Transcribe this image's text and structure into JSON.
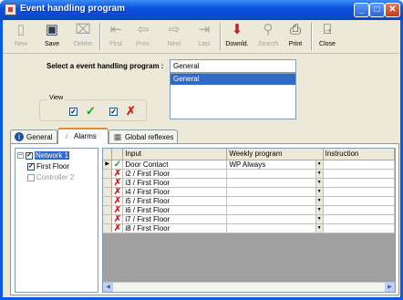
{
  "window": {
    "title": "Event handling program"
  },
  "toolbar": {
    "new": "New",
    "save": "Save",
    "delete": "Delete",
    "first": "First",
    "prev": "Prev.",
    "next": "Next",
    "last": "Last",
    "download": "Downld.",
    "search": "Search",
    "print": "Print",
    "close": "Close"
  },
  "selector": {
    "label": "Select a event handling program :",
    "value": "General",
    "options": [
      "General"
    ]
  },
  "view": {
    "legend": "View",
    "check_mark": "✓",
    "x_mark": "✗"
  },
  "tabs": [
    {
      "label": "General",
      "icon": "info-icon"
    },
    {
      "label": "Alarms",
      "icon": "bell-icon"
    },
    {
      "label": "Global reflexes",
      "icon": "reflex-icon"
    }
  ],
  "tree": {
    "network": "Network 1",
    "first_floor": "First Floor",
    "controller": "Controller  2"
  },
  "grid": {
    "columns": [
      "Input",
      "Weekly program",
      "Instruction"
    ],
    "rows": [
      {
        "status": "ok",
        "input": "Door Contact",
        "weekly": "WP Always",
        "instruction": ""
      },
      {
        "status": "no",
        "input": "i2 / First Floor",
        "weekly": "",
        "instruction": ""
      },
      {
        "status": "no",
        "input": "i3 / First Floor",
        "weekly": "",
        "instruction": ""
      },
      {
        "status": "no",
        "input": "i4 / First Floor",
        "weekly": "",
        "instruction": ""
      },
      {
        "status": "no",
        "input": "i5 / First Floor",
        "weekly": "",
        "instruction": ""
      },
      {
        "status": "no",
        "input": "i6 / First Floor",
        "weekly": "",
        "instruction": ""
      },
      {
        "status": "no",
        "input": "i7 / First Floor",
        "weekly": "",
        "instruction": ""
      },
      {
        "status": "no",
        "input": "i8 / First Floor",
        "weekly": "",
        "instruction": ""
      }
    ]
  },
  "colors": {
    "title_bar": "#0a52de",
    "selection": "#316ac5",
    "ok": "#1c9c1c",
    "no": "#d32020"
  }
}
